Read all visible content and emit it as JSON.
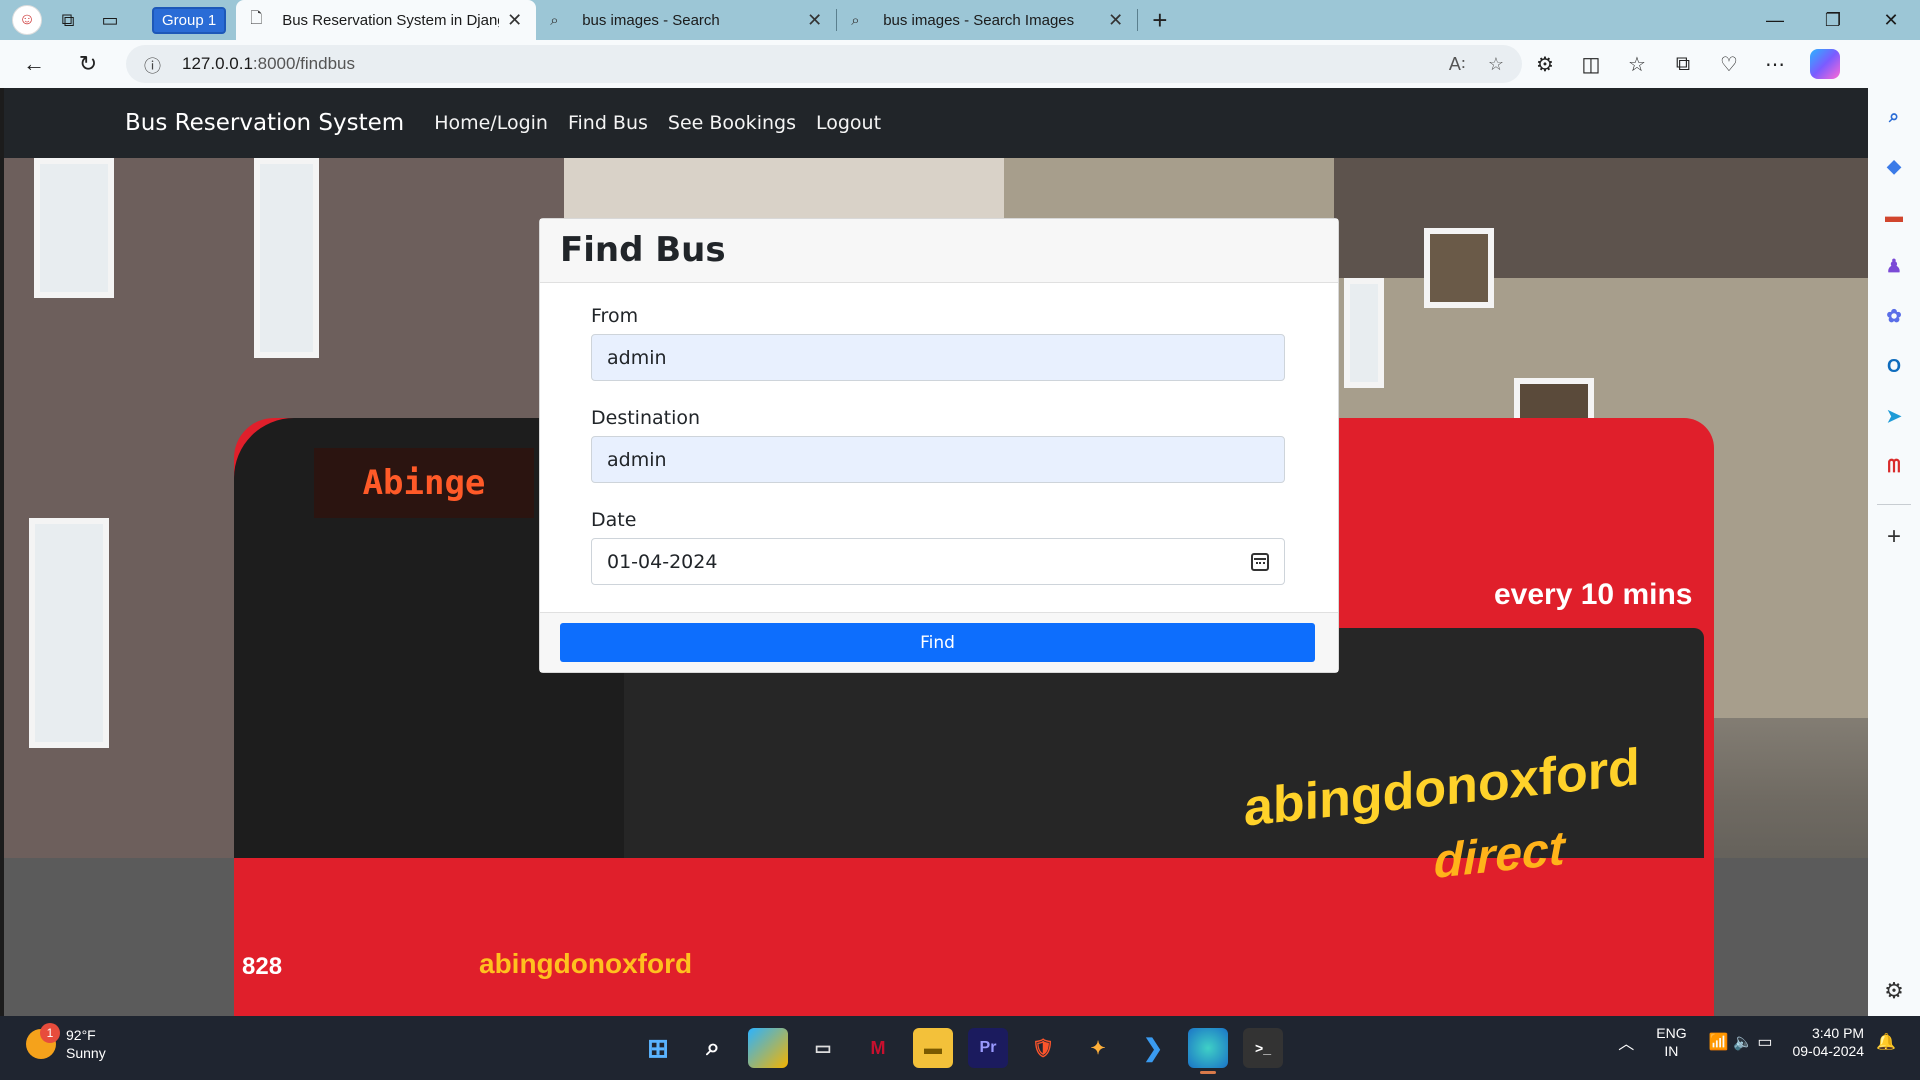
{
  "browser": {
    "group_label": "Group 1",
    "tabs": [
      {
        "title": "Bus Reservation System in Djang",
        "icon": "page-icon",
        "active": true
      },
      {
        "title": "bus images - Search",
        "icon": "search-icon",
        "active": false
      },
      {
        "title": "bus images - Search Images",
        "icon": "search-icon",
        "active": false
      }
    ],
    "url_host": "127.0.0.1",
    "url_path": ":8000/findbus"
  },
  "site": {
    "brand": "Bus Reservation System",
    "nav": [
      "Home/Login",
      "Find Bus",
      "See Bookings",
      "Logout"
    ]
  },
  "form": {
    "title": "Find Bus",
    "from_label": "From",
    "from_value": "admin",
    "destination_label": "Destination",
    "destination_value": "admin",
    "date_label": "Date",
    "date_value": "01-04-2024",
    "submit_label": "Find"
  },
  "hero": {
    "led_text": "Abinge",
    "brand_text": "abingdonoxford",
    "brand_sub": "direct",
    "every_text": "every 10 mins",
    "fleet_number": "828"
  },
  "taskbar": {
    "weather_temp": "92°F",
    "weather_desc": "Sunny",
    "weather_badge": "1",
    "lang_top": "ENG",
    "lang_bottom": "IN",
    "time": "3:40 PM",
    "date": "09-04-2024"
  },
  "colors": {
    "navbar": "#212529",
    "primary_button": "#0d6efd",
    "autofill": "#e8f0fe"
  }
}
